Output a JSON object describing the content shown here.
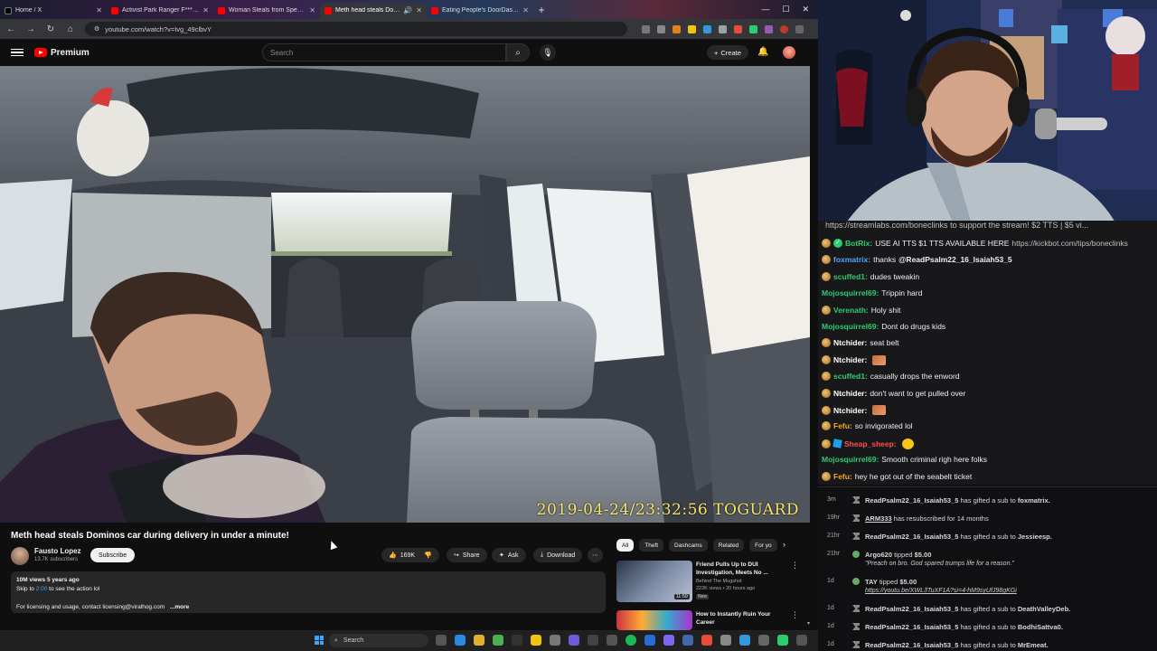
{
  "browser": {
    "tabs": [
      {
        "label": "Home / X",
        "type": "x",
        "active": false
      },
      {
        "label": "Activist Park Ranger F***s Arr",
        "type": "yt",
        "active": false
      },
      {
        "label": "Woman Steals from Special Ne",
        "type": "yt",
        "active": false
      },
      {
        "label": "Meth head steals Domino",
        "type": "yt",
        "active": true
      },
      {
        "label": "Eating People's DoorDash Foo",
        "type": "yt",
        "active": false
      }
    ],
    "url": "youtube.com/watch?v=Ivg_49clbvY"
  },
  "youtube": {
    "brand": "Premium",
    "search_placeholder": "Search",
    "create_label": "Create",
    "video": {
      "timestamp_overlay": "2019-04-24/23:32:56 TOGUARD",
      "title": "Meth head steals Dominos car during delivery in under a minute!",
      "channel": "Fausto Lopez",
      "subscribers": "13.7K subscribers",
      "subscribe_label": "Subscribe",
      "likes": "169K",
      "share_label": "Share",
      "ask_label": "Ask",
      "download_label": "Download",
      "views_age": "10M views  5 years ago",
      "desc_line1_prefix": "Skip to ",
      "desc_link": "2:00",
      "desc_line1_suffix": " to see the action lol",
      "desc_line2": "For licensing and usage, contact licensing@viralhog.com",
      "desc_more": "...more"
    },
    "chips": [
      "All",
      "Theft",
      "Dashcams",
      "Related",
      "For yo"
    ],
    "recommendations": [
      {
        "title": "Friend Pulls Up to DUI Investigation, Meets No ...",
        "channel": "Behind The Mugshot",
        "views": "222K views • 20 hours ago",
        "badge": "New",
        "duration": "11:59"
      },
      {
        "title": "How to Instantly Ruin Your Career",
        "channel": "",
        "views": "",
        "badge": "",
        "duration": ""
      }
    ]
  },
  "taskbar": {
    "search_label": "Search"
  },
  "chat": {
    "pinned_link": "https://streamlabs.com/boneclinks",
    "pinned_text": " to support the stream! $2 TTS | $5 vi...",
    "messages": [
      {
        "user": "BotRix:",
        "color": "#2ecc71",
        "text": " USE AI TTS $1 TTS AVAILABLE HERE ",
        "link": "https://kickbot.com/tips/boneclinks",
        "badge": "verified"
      },
      {
        "user": "foxmatrix:",
        "color": "#4aa8ff",
        "text": " thanks ",
        "mention": "@ReadPsalm22_16_Isaiah53_5",
        "badge": "sub"
      },
      {
        "user": "scuffed1:",
        "color": "#2ecc71",
        "text": " dudes tweakin",
        "badge": "sub"
      },
      {
        "user": "Mojosquirrel69:",
        "color": "#2ecc71",
        "text": " Trippin hard",
        "badge": ""
      },
      {
        "user": "Verenath:",
        "color": "#2ecc71",
        "text": " Holy shit",
        "badge": "sub"
      },
      {
        "user": "Mojosquirrel69:",
        "color": "#2ecc71",
        "text": " Dont do drugs kids",
        "badge": ""
      },
      {
        "user": "Ntchider:",
        "color": "#ffffff",
        "text": " seat belt",
        "badge": "sub"
      },
      {
        "user": "Ntchider:",
        "color": "#ffffff",
        "text": " ",
        "badge": "sub",
        "emote": "face"
      },
      {
        "user": "scuffed1:",
        "color": "#2ecc71",
        "text": " casually drops the enword",
        "badge": "sub"
      },
      {
        "user": "Ntchider:",
        "color": "#ffffff",
        "text": " don't want to get pulled over",
        "badge": "sub"
      },
      {
        "user": "Ntchider:",
        "color": "#ffffff",
        "text": " ",
        "badge": "sub",
        "emote": "face"
      },
      {
        "user": "Fefu:",
        "color": "#f5a623",
        "text": " so invigorated lol",
        "badge": "sub"
      },
      {
        "user": "Sheap_sheep:",
        "color": "#ff4d4d",
        "text": " ",
        "badge": "cube",
        "emote": "yellow"
      },
      {
        "user": "Mojosquirrel69:",
        "color": "#2ecc71",
        "text": " Smooth criminal righ here folks",
        "badge": ""
      },
      {
        "user": "Fefu:",
        "color": "#f5a623",
        "text": " hey he got out of the seabelt ticket",
        "badge": "sub"
      }
    ]
  },
  "events": [
    {
      "time": "3m",
      "user": "ReadPsalm22_16_Isaiah53_5",
      "text": " has gifted a sub to ",
      "target": "foxmatrix."
    },
    {
      "time": "19hr",
      "user": "ARM333",
      "text": " has resubscribed for 14 months",
      "target": ""
    },
    {
      "time": "21hr",
      "user": "ReadPsalm22_16_Isaiah53_5",
      "text": " has gifted a sub to ",
      "target": "Jessieesp."
    },
    {
      "time": "21hr",
      "user": "Argo620",
      "text": " tipped ",
      "target": "$5.00",
      "quote": "\"Preach on bro. God spared trumps life for a reason.\"",
      "tip": true
    },
    {
      "time": "1d",
      "user": "TAY",
      "text": " tipped ",
      "target": "$5.00",
      "quote": "https://youtu.be/XWL3TuXF1A?si=4-hM9syUfJ98gKGi",
      "tip": true
    },
    {
      "time": "1d",
      "user": "ReadPsalm22_16_Isaiah53_5",
      "text": " has gifted a sub to ",
      "target": "DeathValleyDeb."
    },
    {
      "time": "1d",
      "user": "ReadPsalm22_16_Isaiah53_5",
      "text": " has gifted a sub to ",
      "target": "BodhiSattva0."
    },
    {
      "time": "1d",
      "user": "ReadPsalm22_16_Isaiah53_5",
      "text": " has gifted a sub to ",
      "target": "MrEmeat."
    }
  ]
}
